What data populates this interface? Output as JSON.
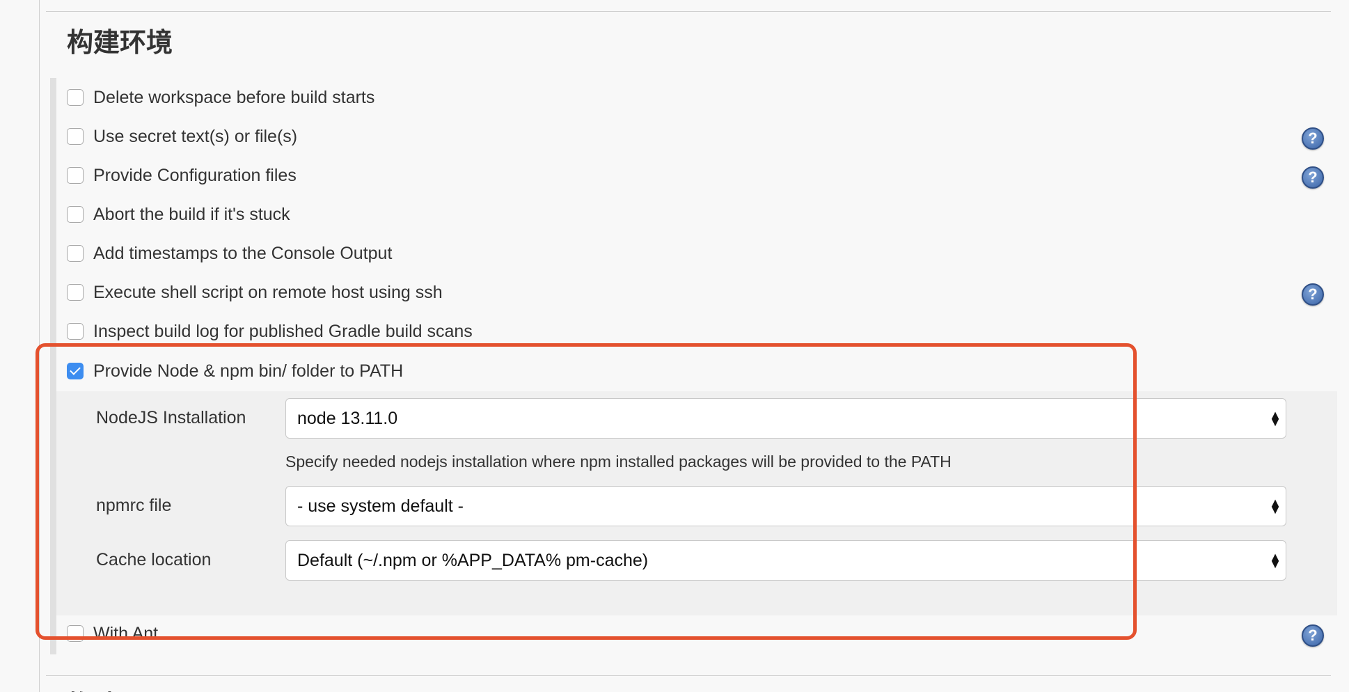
{
  "section": {
    "title": "构建环境",
    "next_title": "构建"
  },
  "options": [
    {
      "label": "Delete workspace before build starts",
      "checked": false,
      "help": false
    },
    {
      "label": "Use secret text(s) or file(s)",
      "checked": false,
      "help": true
    },
    {
      "label": "Provide Configuration files",
      "checked": false,
      "help": true
    },
    {
      "label": "Abort the build if it's stuck",
      "checked": false,
      "help": false
    },
    {
      "label": "Add timestamps to the Console Output",
      "checked": false,
      "help": false
    },
    {
      "label": "Execute shell script on remote host using ssh",
      "checked": false,
      "help": true
    },
    {
      "label": "Inspect build log for published Gradle build scans",
      "checked": false,
      "help": false
    },
    {
      "label": "Provide Node & npm bin/ folder to PATH",
      "checked": true,
      "help": false
    },
    {
      "label": "With Ant",
      "checked": false,
      "help": true
    }
  ],
  "node": {
    "installation_label": "NodeJS Installation",
    "installation_value": "node 13.11.0",
    "installation_hint": "Specify needed nodejs installation where npm installed packages will be provided to the PATH",
    "npmrc_label": "npmrc file",
    "npmrc_value": "- use system default -",
    "cache_label": "Cache location",
    "cache_value": "Default (~/.npm or %APP_DATA% pm-cache)"
  },
  "help_glyph": "?",
  "colors": {
    "highlight": "#e4512e",
    "checkbox_checked": "#3d8df0",
    "help_icon": "#3a64a8"
  }
}
